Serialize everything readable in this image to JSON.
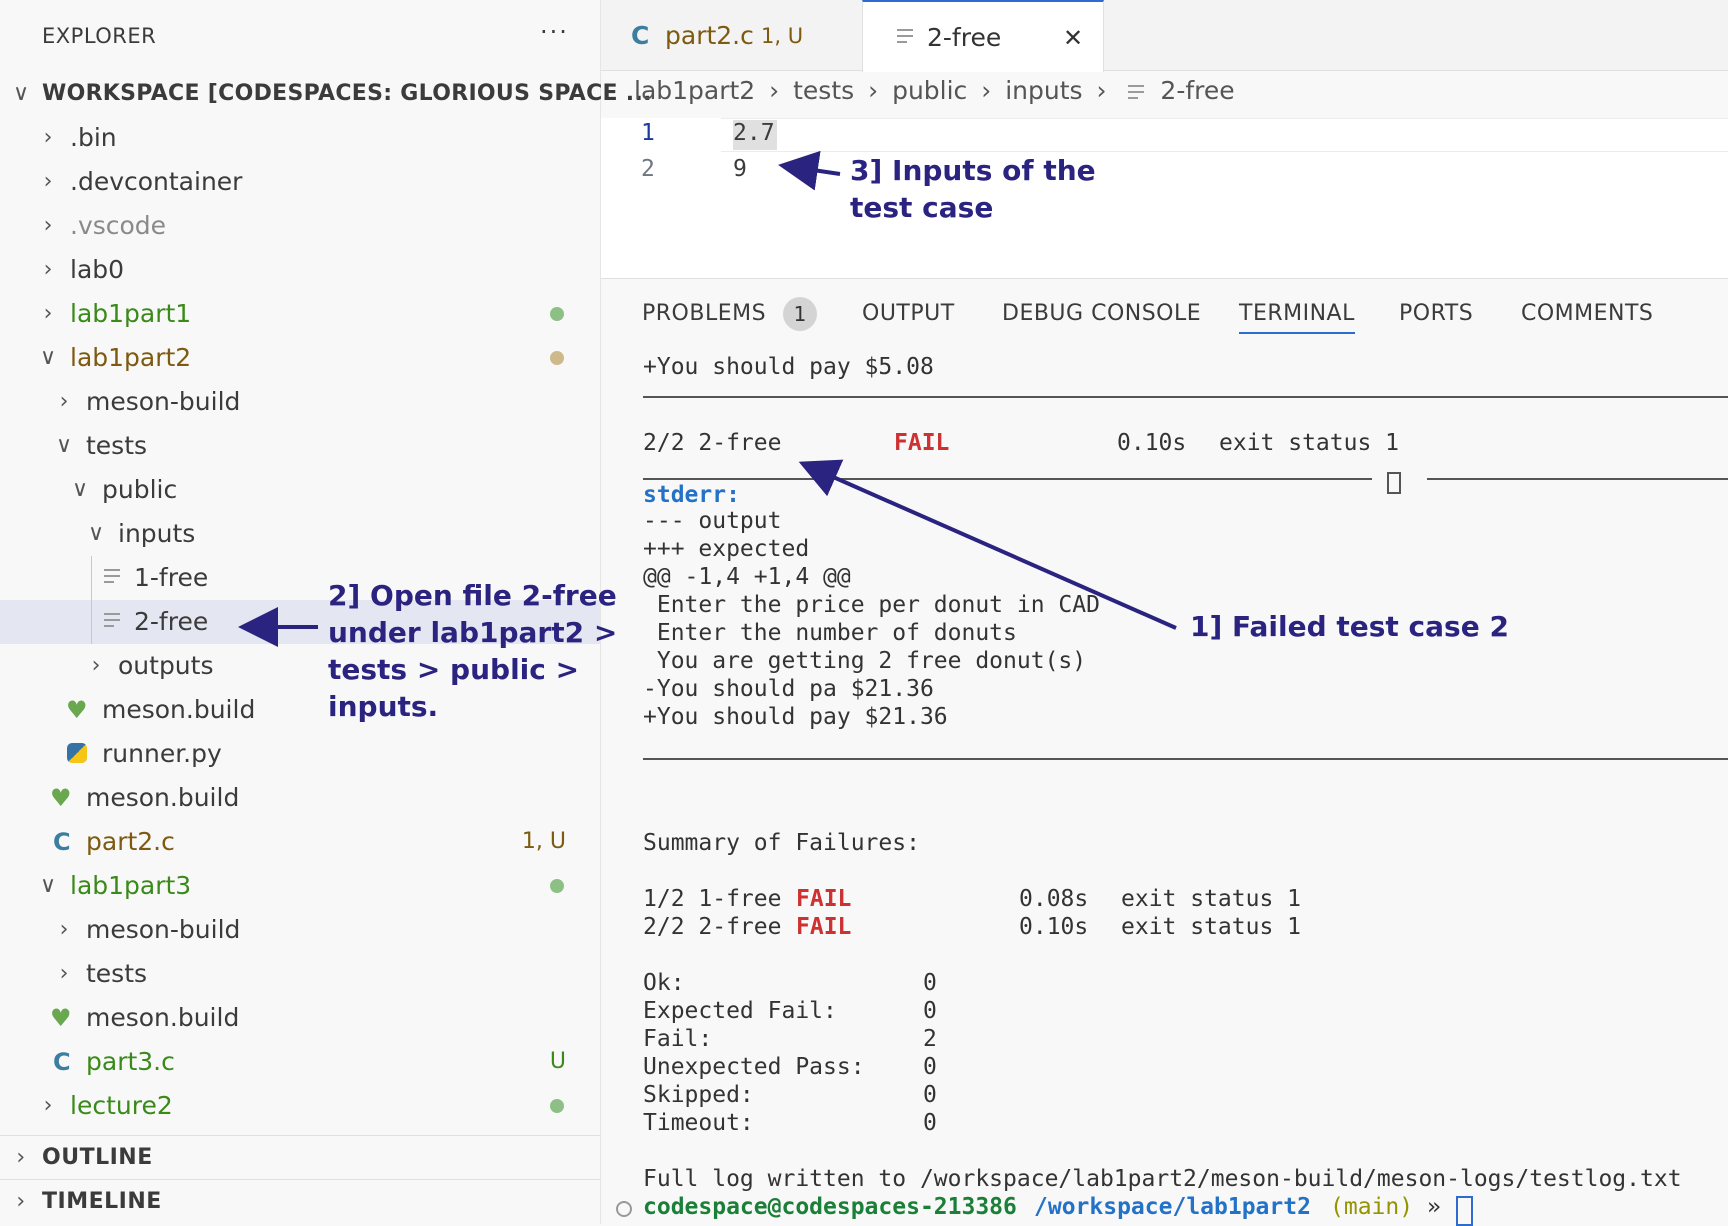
{
  "explorer": {
    "title": "EXPLORER",
    "more": "···",
    "workspace": "WORKSPACE [CODESPACES: GLORIOUS SPACE ...",
    "items": [
      {
        "label": ".bin"
      },
      {
        "label": ".devcontainer"
      },
      {
        "label": ".vscode"
      },
      {
        "label": "lab0"
      },
      {
        "label": "lab1part1"
      },
      {
        "label": "lab1part2"
      },
      {
        "label": "meson-build"
      },
      {
        "label": "tests"
      },
      {
        "label": "public"
      },
      {
        "label": "inputs"
      },
      {
        "label": "1-free"
      },
      {
        "label": "2-free"
      },
      {
        "label": "outputs"
      },
      {
        "label": "meson.build"
      },
      {
        "label": "runner.py"
      },
      {
        "label": "meson.build"
      },
      {
        "label": "part2.c",
        "badge": "1, U"
      },
      {
        "label": "lab1part3"
      },
      {
        "label": "meson-build"
      },
      {
        "label": "tests"
      },
      {
        "label": "meson.build"
      },
      {
        "label": "part3.c",
        "badge": "U"
      },
      {
        "label": "lecture2"
      }
    ],
    "outline": "OUTLINE",
    "timeline": "TIMELINE"
  },
  "tabs": [
    {
      "icon": "C",
      "label": "part2.c",
      "badge": "1, U"
    },
    {
      "label": "2-free",
      "close": "✕"
    }
  ],
  "breadcrumb": [
    "lab1part2",
    "tests",
    "public",
    "inputs",
    "2-free"
  ],
  "editor": {
    "lines": [
      {
        "num": "1",
        "text": "2.7"
      },
      {
        "num": "2",
        "text": "9"
      }
    ]
  },
  "panel": {
    "tabs": [
      "PROBLEMS",
      "OUTPUT",
      "DEBUG CONSOLE",
      "TERMINAL",
      "PORTS",
      "COMMENTS"
    ],
    "problems_count": "1",
    "terminal": {
      "l1": "+You should pay $5.08",
      "test_id": "2/2 2-free",
      "test_status": "FAIL",
      "test_time": "0.10s",
      "test_exit": "exit status 1",
      "stderr": "stderr:",
      "diff": [
        "--- output",
        "+++ expected",
        "@@ -1,4 +1,4 @@",
        " Enter the price per donut in CAD",
        " Enter the number of donuts",
        " You are getting 2 free donut(s)",
        "-You should pa $21.36",
        "+You should pay $21.36"
      ],
      "summary_title": "Summary of Failures:",
      "summary": [
        {
          "id": "1/2 1-free",
          "status": "FAIL",
          "time": "0.08s",
          "exit": "exit status 1"
        },
        {
          "id": "2/2 2-free",
          "status": "FAIL",
          "time": "0.10s",
          "exit": "exit status 1"
        }
      ],
      "stats": [
        {
          "label": "Ok:",
          "value": "0"
        },
        {
          "label": "Expected Fail:",
          "value": "0"
        },
        {
          "label": "Fail:",
          "value": "2"
        },
        {
          "label": "Unexpected Pass:",
          "value": "0"
        },
        {
          "label": "Skipped:",
          "value": "0"
        },
        {
          "label": "Timeout:",
          "value": "0"
        }
      ],
      "log": "Full log written to /workspace/lab1part2/meson-build/meson-logs/testlog.txt",
      "prompt_user": "codespace@codespaces-213386",
      "prompt_path": "/workspace/lab1part2",
      "prompt_branch": "(main)",
      "prompt_sym": "»"
    }
  },
  "annotations": {
    "a1": "1] Failed test case 2",
    "a2": [
      "2] Open file 2-free",
      "under lab1part2 >",
      "tests > public >",
      "inputs."
    ],
    "a3": [
      "3] Inputs of the",
      "test case"
    ]
  },
  "colors": {
    "annotation": "#2a2380",
    "fail": "#cd3131",
    "accent": "#2e6bd1"
  }
}
